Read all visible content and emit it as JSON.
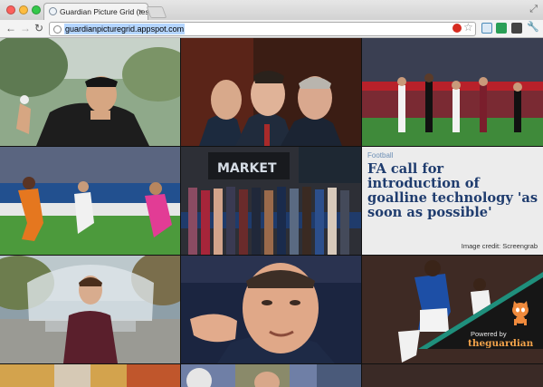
{
  "window": {
    "tab_title": "Guardian Picture Grid (test)",
    "url": "guardianpicturegrid.appspot.com"
  },
  "toolbar_icons": [
    "back-icon",
    "forward-icon",
    "reload-icon",
    "globe-icon",
    "adblock-icon",
    "bookmark-star-icon",
    "extension-icon",
    "extension-icon",
    "camera-icon",
    "wrench-icon"
  ],
  "tiles": [
    {
      "name": "photo-golfer",
      "desc": "golfer"
    },
    {
      "name": "photo-politicians",
      "desc": "politicians"
    },
    {
      "name": "photo-football-match",
      "desc": "football"
    },
    {
      "name": "photo-football-striker",
      "desc": "football"
    },
    {
      "name": "photo-stock-exchange",
      "desc": "stock exchange"
    },
    {
      "name": "photo-man-fountain",
      "desc": "portrait"
    },
    {
      "name": "photo-politician-gesture",
      "desc": "politician"
    },
    {
      "name": "photo-footballer-celebrates",
      "desc": "football"
    }
  ],
  "featured_article": {
    "section": "Football",
    "headline": "FA call for introduction of goalline technology 'as soon as possible'",
    "credit": "Image credit: Screengrab"
  },
  "badge": {
    "powered_by": "Powered by",
    "brand": "theguardian"
  },
  "colors": {
    "headline": "#1f3c6e",
    "section": "#6d8fb5",
    "badge_band": "#1f8f7c",
    "badge_bg": "#161616",
    "brand": "#f2a24a"
  }
}
